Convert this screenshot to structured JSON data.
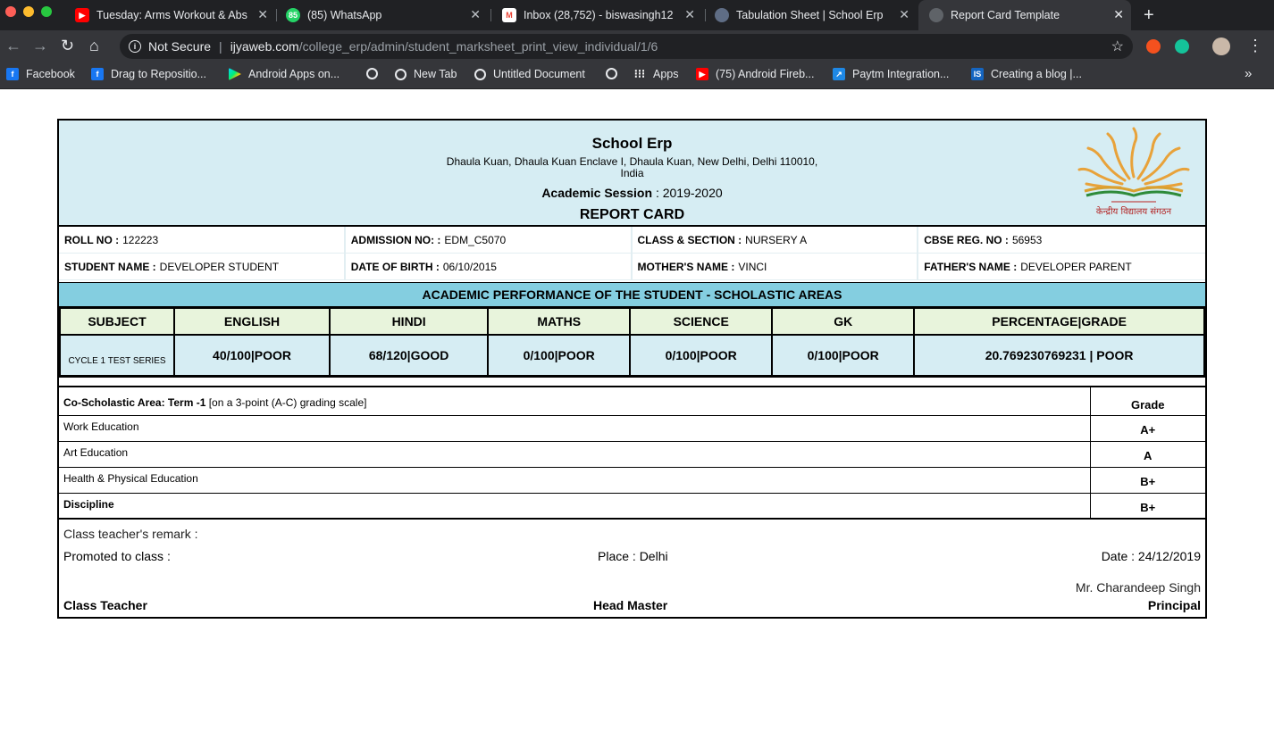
{
  "browser": {
    "tabs": [
      {
        "title": "Tuesday: Arms Workout & Abs",
        "icon": "youtube-icon",
        "color": "#ff0000"
      },
      {
        "title": "(85) WhatsApp",
        "icon": "whatsapp-icon",
        "color": "#25d366",
        "badge": "85"
      },
      {
        "title": "Inbox (28,752) - biswasingh12",
        "icon": "gmail-icon",
        "color": "#ea4335"
      },
      {
        "title": "Tabulation Sheet | School Erp",
        "icon": "school-icon",
        "color": "#5f6368"
      },
      {
        "title": "Report Card Template",
        "icon": "globe-icon",
        "color": "#5f6368"
      }
    ],
    "close_glyph": "✕",
    "new_tab_glyph": "+",
    "security_label": "Not Secure",
    "url_host": "ijyaweb.com",
    "url_path": "/college_erp/admin/student_marksheet_print_view_individual/1/6",
    "bookmarks": [
      {
        "label": "Facebook",
        "icon": "facebook-icon"
      },
      {
        "label": "Drag to Repositio...",
        "icon": "facebook-icon"
      },
      {
        "label": "Android Apps on...",
        "icon": "play-store-icon"
      },
      {
        "label": "",
        "icon": "globe-icon"
      },
      {
        "label": "New Tab",
        "icon": "globe-icon"
      },
      {
        "label": "Untitled Document",
        "icon": "globe-icon"
      },
      {
        "label": "",
        "icon": "globe-icon"
      },
      {
        "label": "Apps",
        "icon": "apps-grid-icon"
      },
      {
        "label": "(75) Android Fireb...",
        "icon": "youtube-icon"
      },
      {
        "label": "Paytm Integration...",
        "icon": "paytm-icon"
      },
      {
        "label": "Creating a blog |...",
        "icon": "is-icon"
      }
    ],
    "overflow_glyph": "»"
  },
  "report": {
    "school_name": "School Erp",
    "address_line1": "Dhaula Kuan, Dhaula Kuan Enclave I, Dhaula Kuan, New Delhi, Delhi 110010,",
    "address_line2": "India",
    "session_label": "Academic Session",
    "session_value": ": 2019-2020",
    "title": "REPORT CARD",
    "logo_text": "केन्द्रीय विद्यालय संगठन",
    "info": [
      [
        {
          "label": "ROLL NO :",
          "value": "122223"
        },
        {
          "label": "ADMISSION NO: :",
          "value": "EDM_C5070"
        },
        {
          "label": "CLASS & SECTION :",
          "value": "NURSERY A"
        },
        {
          "label": "CBSE REG. NO :",
          "value": "56953"
        }
      ],
      [
        {
          "label": "STUDENT NAME :",
          "value": "DEVELOPER STUDENT"
        },
        {
          "label": "DATE OF BIRTH :",
          "value": "06/10/2015"
        },
        {
          "label": "MOTHER'S NAME :",
          "value": "VINCI"
        },
        {
          "label": "FATHER'S NAME :",
          "value": "DEVELOPER PARENT"
        }
      ]
    ],
    "academic_title": "ACADEMIC PERFORMANCE OF THE STUDENT - SCHOLASTIC AREAS",
    "marks_headers": [
      "SUBJECT",
      "ENGLISH",
      "HINDI",
      "MATHS",
      "SCIENCE",
      "GK",
      "PERCENTAGE|GRADE"
    ],
    "marks_row": [
      "CYCLE 1 TEST SERIES",
      "40/100|POOR",
      "68/120|GOOD",
      "0/100|POOR",
      "0/100|POOR",
      "0/100|POOR",
      "20.769230769231 | POOR"
    ],
    "co_title_bold": "Co-Scholastic Area: Term -1",
    "co_title_rest": " [on a 3-point (A-C) grading scale]",
    "grade_header": "Grade",
    "co_rows": [
      {
        "area": "Work Education",
        "grade": "A+"
      },
      {
        "area": "Art Education",
        "grade": "A"
      },
      {
        "area": "Health & Physical Education",
        "grade": "B+"
      },
      {
        "area": "Discipline",
        "grade": "B+"
      }
    ],
    "remark_label": "Class teacher's remark :",
    "promoted_label": "Promoted to class :",
    "place_label": "Place : Delhi",
    "date_label": "Date : 24/12/2019",
    "principal_name": "Mr. Charandeep Singh",
    "sig_class_teacher": "Class Teacher",
    "sig_head_master": "Head Master",
    "sig_principal": "Principal"
  }
}
